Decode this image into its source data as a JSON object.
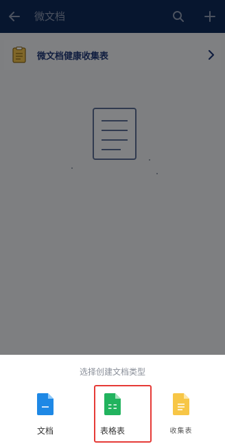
{
  "topbar": {
    "title": "微文档",
    "back_icon": "arrow-left-icon",
    "search_icon": "search-icon",
    "add_icon": "plus-icon"
  },
  "list": {
    "items": [
      {
        "label": "微文档健康收集表",
        "icon": "form-document-icon"
      }
    ]
  },
  "empty_state": {
    "icon": "document-outline-icon"
  },
  "sheet": {
    "title": "选择创建文档类型",
    "options": [
      {
        "label": "文档",
        "icon": "doc-icon",
        "color": "#1e88e5"
      },
      {
        "label": "表格表",
        "icon": "spreadsheet-icon",
        "color": "#21b35e"
      },
      {
        "label": "收集表",
        "icon": "form-icon",
        "color": "#f7c646"
      }
    ]
  },
  "colors": {
    "topbar": "#0f2a5a",
    "highlight": "#e53935"
  }
}
